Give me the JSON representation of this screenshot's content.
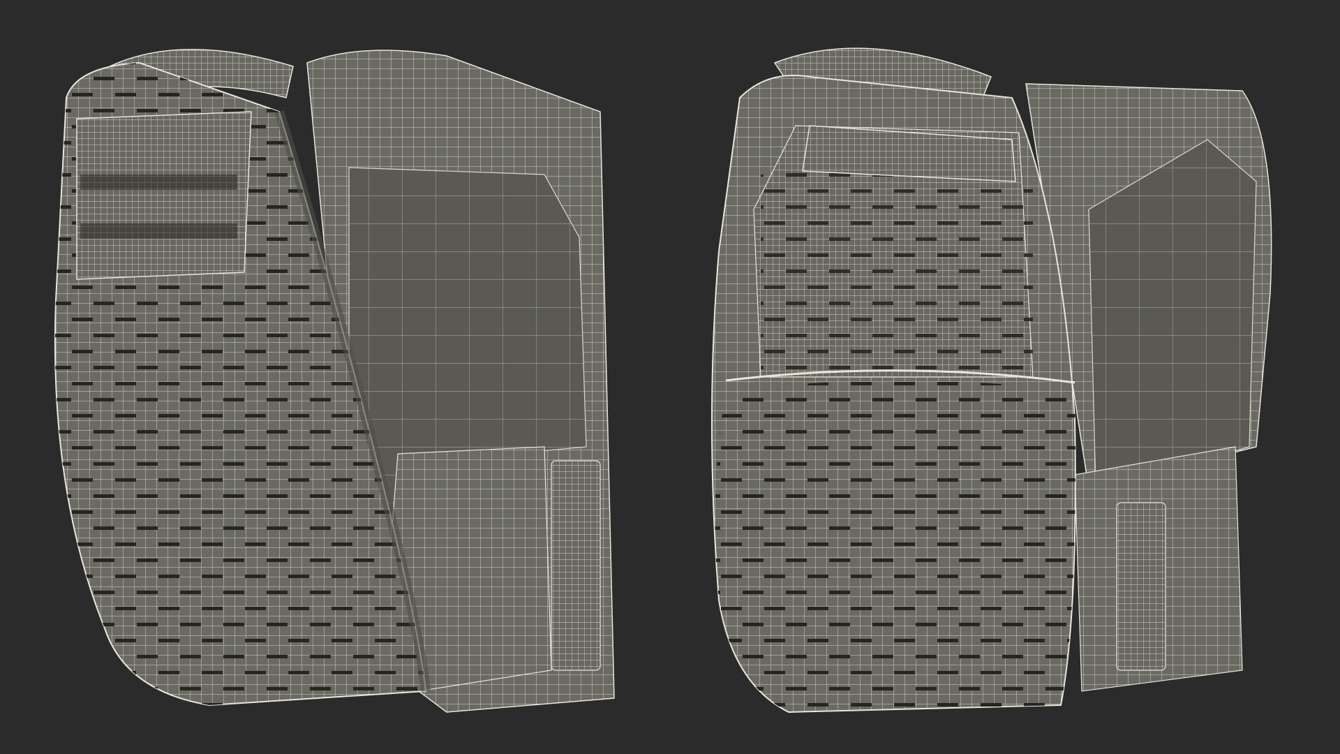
{
  "scene": {
    "background_color": "#2b2b2b",
    "objects": [
      {
        "id": "vest-left",
        "description_icon": "plate-carrier-vest-icon"
      },
      {
        "id": "vest-right",
        "description_icon": "plate-carrier-vest-icon"
      }
    ],
    "colors": {
      "surface": "#6a6a62",
      "surface_dark": "#4e4e48",
      "interior": "#5a5a53",
      "wire": "#e8e6dc",
      "slot": "#26261f"
    }
  }
}
